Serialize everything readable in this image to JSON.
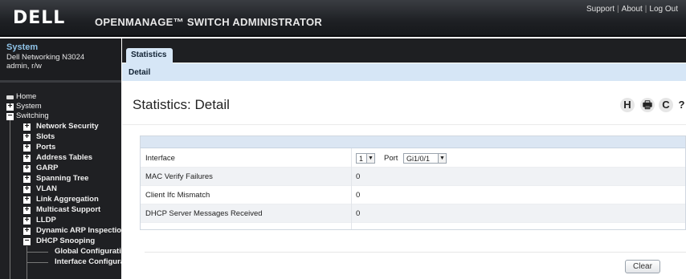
{
  "header": {
    "logo": "D&LL",
    "app_title": "OPENMANAGE™ SWITCH ADMINISTRATOR",
    "links": [
      "Support",
      "About",
      "Log Out"
    ]
  },
  "system": {
    "title": "System",
    "model": "Dell Networking N3024",
    "user": "admin, r/w"
  },
  "nav": {
    "home": "Home",
    "system": "System",
    "switching": "Switching",
    "items": [
      "Network Security",
      "Slots",
      "Ports",
      "Address Tables",
      "GARP",
      "Spanning Tree",
      "VLAN",
      "Link Aggregation",
      "Multicast Support",
      "LLDP",
      "Dynamic ARP Inspection",
      "DHCP Snooping"
    ],
    "sub_items": [
      "Global Configuratio",
      "Interface Configurat"
    ]
  },
  "tabs": {
    "main": "Statistics",
    "sub": "Detail"
  },
  "page": {
    "title": "Statistics: Detail"
  },
  "tools": [
    "H",
    "🖶",
    "C",
    "?"
  ],
  "form": {
    "rows": [
      {
        "label": "Interface",
        "value": ""
      },
      {
        "label": "MAC Verify Failures",
        "value": "0"
      },
      {
        "label": "Client Ifc Mismatch",
        "value": "0"
      },
      {
        "label": "DHCP Server Messages Received",
        "value": "0"
      }
    ],
    "unit_select": "1",
    "port_label": "Port",
    "port_select": "Gi1/0/1"
  },
  "buttons": {
    "clear": "Clear"
  }
}
